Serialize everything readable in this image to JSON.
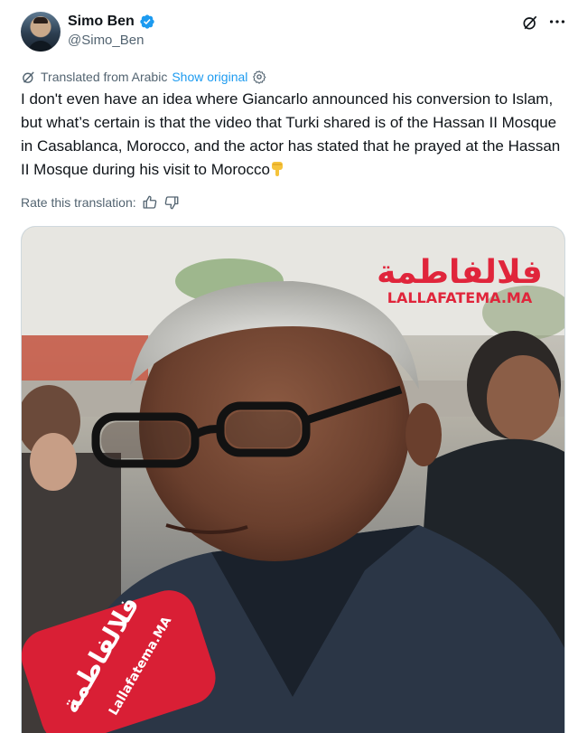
{
  "author": {
    "display_name": "Simo Ben",
    "handle": "@Simo_Ben",
    "verified": true,
    "avatar": "profile-photo"
  },
  "header_icons": [
    "grok-icon",
    "more-icon"
  ],
  "translation": {
    "label": "Translated from Arabic",
    "show_original": "Show original",
    "icons": [
      "translate-icon",
      "settings-icon"
    ]
  },
  "tweet": {
    "text": "I don't even have an idea where Giancarlo announced his conversion to Islam, but what’s certain is that the video that Turki shared is of the Hassan II Mosque in Casablanca, Morocco, and the actor has stated that he prayed at the Hassan II Mosque during his visit to Morocco",
    "emoji": "pointing-down-emoji"
  },
  "rating": {
    "label": "Rate this translation:",
    "icons": [
      "thumbs-up-icon",
      "thumbs-down-icon"
    ]
  },
  "media": {
    "watermark_arabic": "فلالفاطمة",
    "watermark_latin": "LALLAFATEMA.MA",
    "mic_flag_arabic": "فلالفاطمة",
    "mic_flag_latin": "Lallafatema.MA"
  },
  "colors": {
    "link": "#1d9bf0",
    "verified": "#1d9bf0",
    "secondary_text": "#536471",
    "watermark": "#e0253b"
  }
}
